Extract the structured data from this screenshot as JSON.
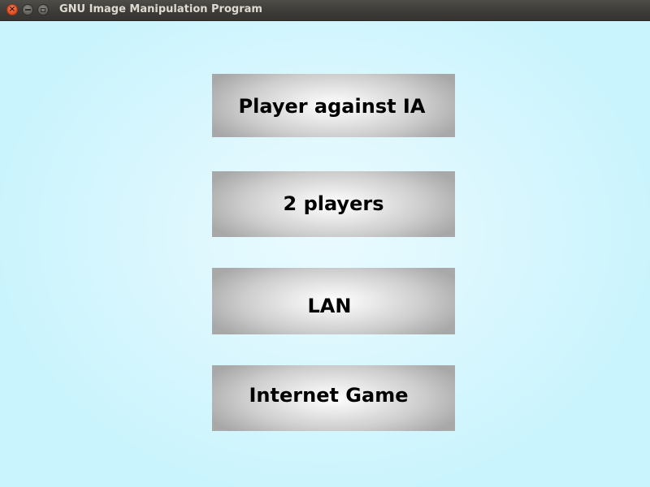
{
  "window": {
    "title": "GNU Image Manipulation Program",
    "controls": {
      "close_icon": "close-icon",
      "minimize_icon": "minimize-icon",
      "maximize_icon": "maximize-icon"
    }
  },
  "menu": {
    "buttons": [
      {
        "label": "Player against IA"
      },
      {
        "label": "2 players"
      },
      {
        "label": "LAN"
      },
      {
        "label": "Internet Game"
      }
    ]
  },
  "colors": {
    "background": "#cff6fd",
    "titlebar": "#3d3c38",
    "close_button": "#e5552a",
    "button_center": "#ffffff",
    "button_edge": "#a8a8a8",
    "button_text": "#000000"
  }
}
